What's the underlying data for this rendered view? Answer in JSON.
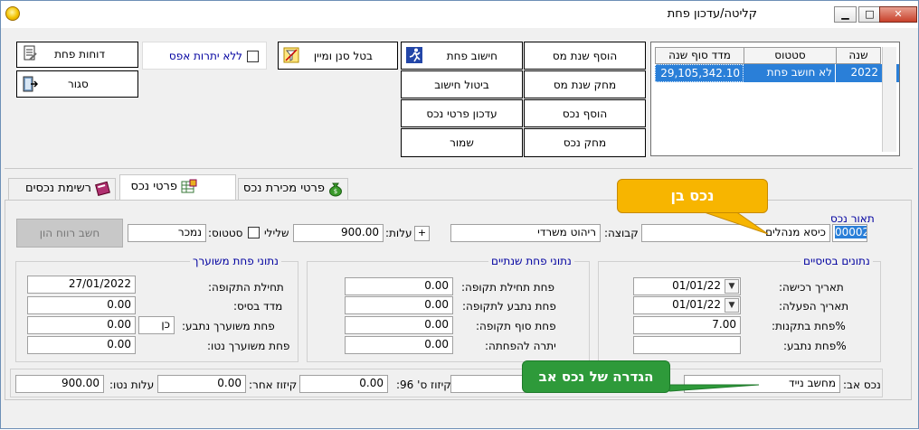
{
  "window": {
    "title": "קליטה/עדכון פחת",
    "minimize": "▁",
    "maximize": "□",
    "close": "✕"
  },
  "toolbar": {
    "reports": "דוחות פחת",
    "close": "סגור",
    "no_zero_balance": "ללא יתרות אפס",
    "cancel_filter_sort": "בטל סנן ומיין",
    "calc_depreciation": "חישוב פחת",
    "add_tax_year": "הוסף שנת מס",
    "cancel_calc": "ביטול חישוב",
    "delete_tax_year": "מחק שנת מס",
    "update_asset_details": "עדכון פרטי נכס",
    "add_asset": "הוסף נכס",
    "save": "שמור",
    "delete_asset": "מחק נכס"
  },
  "years_table": {
    "headers": [
      "שנה",
      "סטטוס",
      "מדד סוף שנה"
    ],
    "rows": [
      {
        "year": "2022",
        "status": "לא חושב פחת",
        "index": "29,105,342.10"
      }
    ]
  },
  "tabs": {
    "assets_list": "רשימת נכסים",
    "asset_details": "פרטי נכס",
    "asset_sale": "פרטי מכירת נכס"
  },
  "callouts": {
    "child_asset": "נכס בן",
    "parent_asset_def": "הגדרה של נכס אב"
  },
  "asset": {
    "desc_label": "תאור נכס",
    "number": "00002",
    "description": "כיסא מנהלים",
    "group_label": "קבוצה:",
    "group": "ריהוט משרדי",
    "cost_label": "עלות:",
    "plus": "+",
    "cost": "900.00",
    "negative_label": "שלילי",
    "status_label": "סטטוס:",
    "status": "נמכר",
    "capital_gain_btn": "חשב רווח הון"
  },
  "basic_data": {
    "title": "נתונים בסיסיים",
    "purchase_date_label": "תאריך רכישה:",
    "purchase_date": "01/01/22",
    "operation_date_label": "תאריך הפעלה:",
    "operation_date": "01/01/22",
    "reg_pct_label": "%פחת בתקנות:",
    "reg_pct": "7.00",
    "req_pct_label": "%פחת נתבע:",
    "req_pct": ""
  },
  "annual_data": {
    "title": "נתוני פחת שנתיים",
    "start_label": "פחת תחילת תקופה:",
    "start": "0.00",
    "claimed_label": "פחת נתבע לתקופה:",
    "claimed": "0.00",
    "end_label": "פחת סוף תקופה:",
    "end": "0.00",
    "remaining_label": "יתרה להפחתה:",
    "remaining": "0.00"
  },
  "linked_data": {
    "title": "נתוני פחת משוערך",
    "period_start_label": "תחילת התקופה:",
    "period_start": "27/01/2022",
    "base_index_label": "מדד בסיס:",
    "base_index": "0.00",
    "claimed_linked_label": "פחת משוערך נתבע:",
    "claimed_linked": "0.00",
    "yes_no": "כן",
    "net_linked_label": "פחת משוערך נטו:",
    "net_linked": "0.00"
  },
  "footer": {
    "parent_label": "נכס אב:",
    "parent": "מחשב נייד",
    "sec96_label": "קיזוז ס' 96:",
    "sec96": "0.00",
    "other_label": "קיזוז אחר:",
    "other": "0.00",
    "net_cost_label": "עלות נטו:",
    "net_cost": "900.00"
  }
}
